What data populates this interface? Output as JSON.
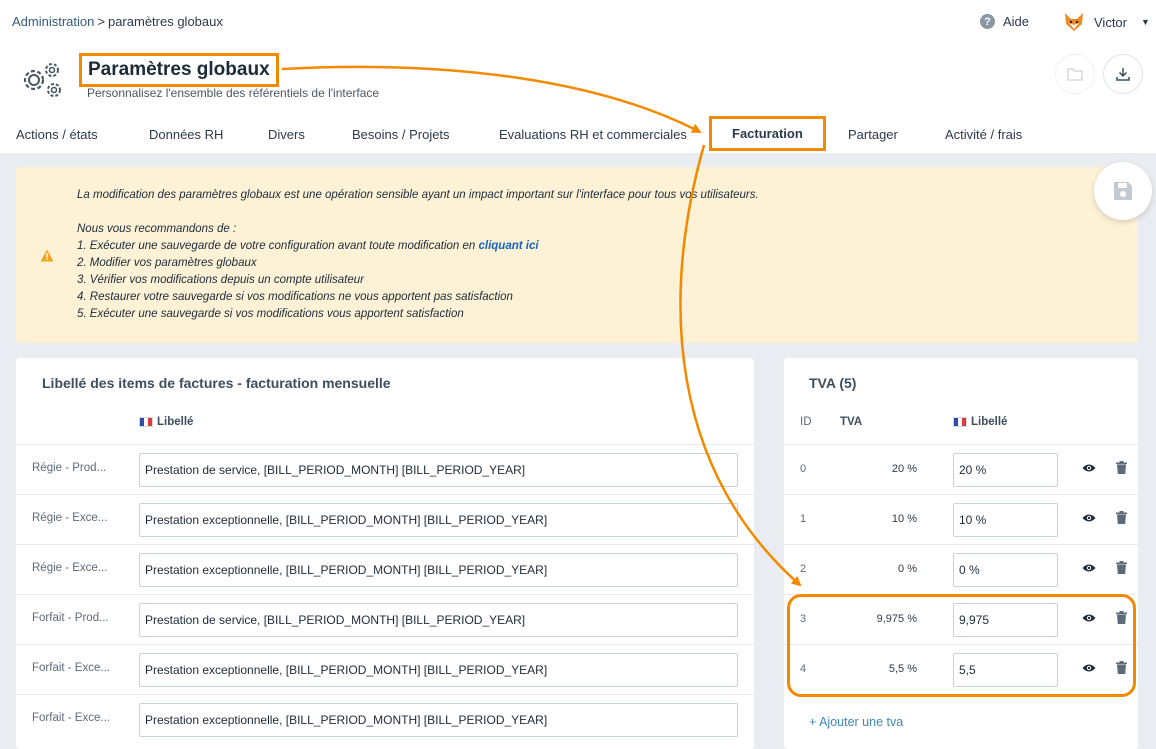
{
  "breadcrumb": {
    "root": "Administration",
    "separator": ">",
    "current": "paramètres globaux"
  },
  "header": {
    "help_label": "Aide",
    "user_name": "Victor",
    "title": "Paramètres globaux",
    "subtitle": "Personnalisez l'ensemble des référentiels de l'interface"
  },
  "tabs": [
    {
      "label": "Actions / états"
    },
    {
      "label": "Données RH"
    },
    {
      "label": "Divers"
    },
    {
      "label": "Besoins / Projets"
    },
    {
      "label": "Evaluations RH et commerciales"
    },
    {
      "label": "Facturation",
      "active": true
    },
    {
      "label": "Partager"
    },
    {
      "label": "Activité / frais"
    }
  ],
  "notice": {
    "line1": "La modification des paramètres globaux est une opération sensible ayant un impact important sur l'interface pour tous vos utilisateurs.",
    "line2": "Nous vous recommandons de :",
    "line3_prefix": "1. Exécuter une sauvegarde de votre configuration avant toute modification en ",
    "line3_link": "cliquant ici",
    "line4": "2. Modifier vos paramètres globaux",
    "line5": "3. Vérifier vos modifications depuis un compte utilisateur",
    "line6": "4. Restaurer votre sauvegarde si vos modifications ne vous apportent pas satisfaction",
    "line7": "5. Exécuter une sauvegarde si vos modifications vous apportent satisfaction"
  },
  "invoice_items": {
    "title": "Libellé des items de factures - facturation mensuelle",
    "col_label": "Libellé",
    "rows": [
      {
        "name": "Régie - Prod...",
        "value": "Prestation de service, [BILL_PERIOD_MONTH] [BILL_PERIOD_YEAR]"
      },
      {
        "name": "Régie - Exce...",
        "value": "Prestation exceptionnelle, [BILL_PERIOD_MONTH] [BILL_PERIOD_YEAR]"
      },
      {
        "name": "Régie - Exce...",
        "value": "Prestation exceptionnelle, [BILL_PERIOD_MONTH] [BILL_PERIOD_YEAR]"
      },
      {
        "name": "Forfait - Prod...",
        "value": "Prestation de service, [BILL_PERIOD_MONTH] [BILL_PERIOD_YEAR]"
      },
      {
        "name": "Forfait - Exce...",
        "value": "Prestation exceptionnelle, [BILL_PERIOD_MONTH] [BILL_PERIOD_YEAR]"
      },
      {
        "name": "Forfait - Exce...",
        "value": "Prestation exceptionnelle, [BILL_PERIOD_MONTH] [BILL_PERIOD_YEAR]"
      }
    ]
  },
  "tva": {
    "title": "TVA (5)",
    "col_id": "ID",
    "col_tva": "TVA",
    "col_label": "Libellé",
    "rows": [
      {
        "id": "0",
        "rate": "20 %",
        "label": "20 %"
      },
      {
        "id": "1",
        "rate": "10 %",
        "label": "10 %"
      },
      {
        "id": "2",
        "rate": "0 %",
        "label": "0 %"
      },
      {
        "id": "3",
        "rate": "9,975 %",
        "label": "9,975"
      },
      {
        "id": "4",
        "rate": "5,5 %",
        "label": "5,5"
      }
    ],
    "add_label": "+ Ajouter une tva"
  },
  "colors": {
    "annotation": "#f28a00",
    "link": "#1565c0",
    "notice_bg": "#fdf1d6"
  }
}
